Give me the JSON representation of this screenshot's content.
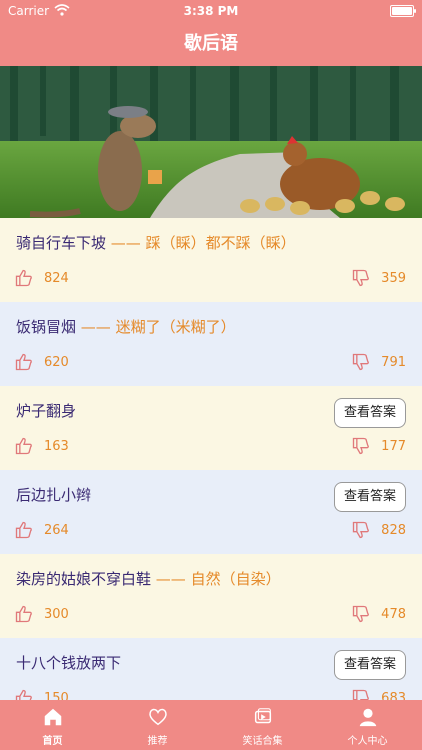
{
  "status": {
    "carrier": "Carrier",
    "time": "3:38 PM"
  },
  "nav": {
    "title": "歇后语"
  },
  "cards": [
    {
      "question": "骑自行车下坡",
      "sep": " —— ",
      "answer": "踩（睬）都不踩（睬）",
      "likes": "824",
      "dislikes": "359",
      "button": ""
    },
    {
      "question": "饭锅冒烟",
      "sep": " —— ",
      "answer": "迷糊了（米糊了）",
      "likes": "620",
      "dislikes": "791",
      "button": ""
    },
    {
      "question": "炉子翻身",
      "sep": "",
      "answer": "",
      "likes": "163",
      "dislikes": "177",
      "button": "查看答案"
    },
    {
      "question": "后边扎小辫",
      "sep": "",
      "answer": "",
      "likes": "264",
      "dislikes": "828",
      "button": "查看答案"
    },
    {
      "question": "染房的姑娘不穿白鞋",
      "sep": " —— ",
      "answer": "自然（自染）",
      "likes": "300",
      "dislikes": "478",
      "button": ""
    },
    {
      "question": "十八个钱放两下",
      "sep": "",
      "answer": "",
      "likes": "150",
      "dislikes": "683",
      "button": "查看答案"
    }
  ],
  "tabs": [
    {
      "label": "首页",
      "icon": "home-icon"
    },
    {
      "label": "推荐",
      "icon": "heart-icon"
    },
    {
      "label": "笑话合集",
      "icon": "video-icon"
    },
    {
      "label": "个人中心",
      "icon": "person-icon"
    }
  ],
  "colors": {
    "theme": "#f08a86",
    "answer": "#e58a2a",
    "question": "#3a2a73",
    "card_yellow": "#fbf7e3",
    "card_blue": "#e8eef9"
  }
}
